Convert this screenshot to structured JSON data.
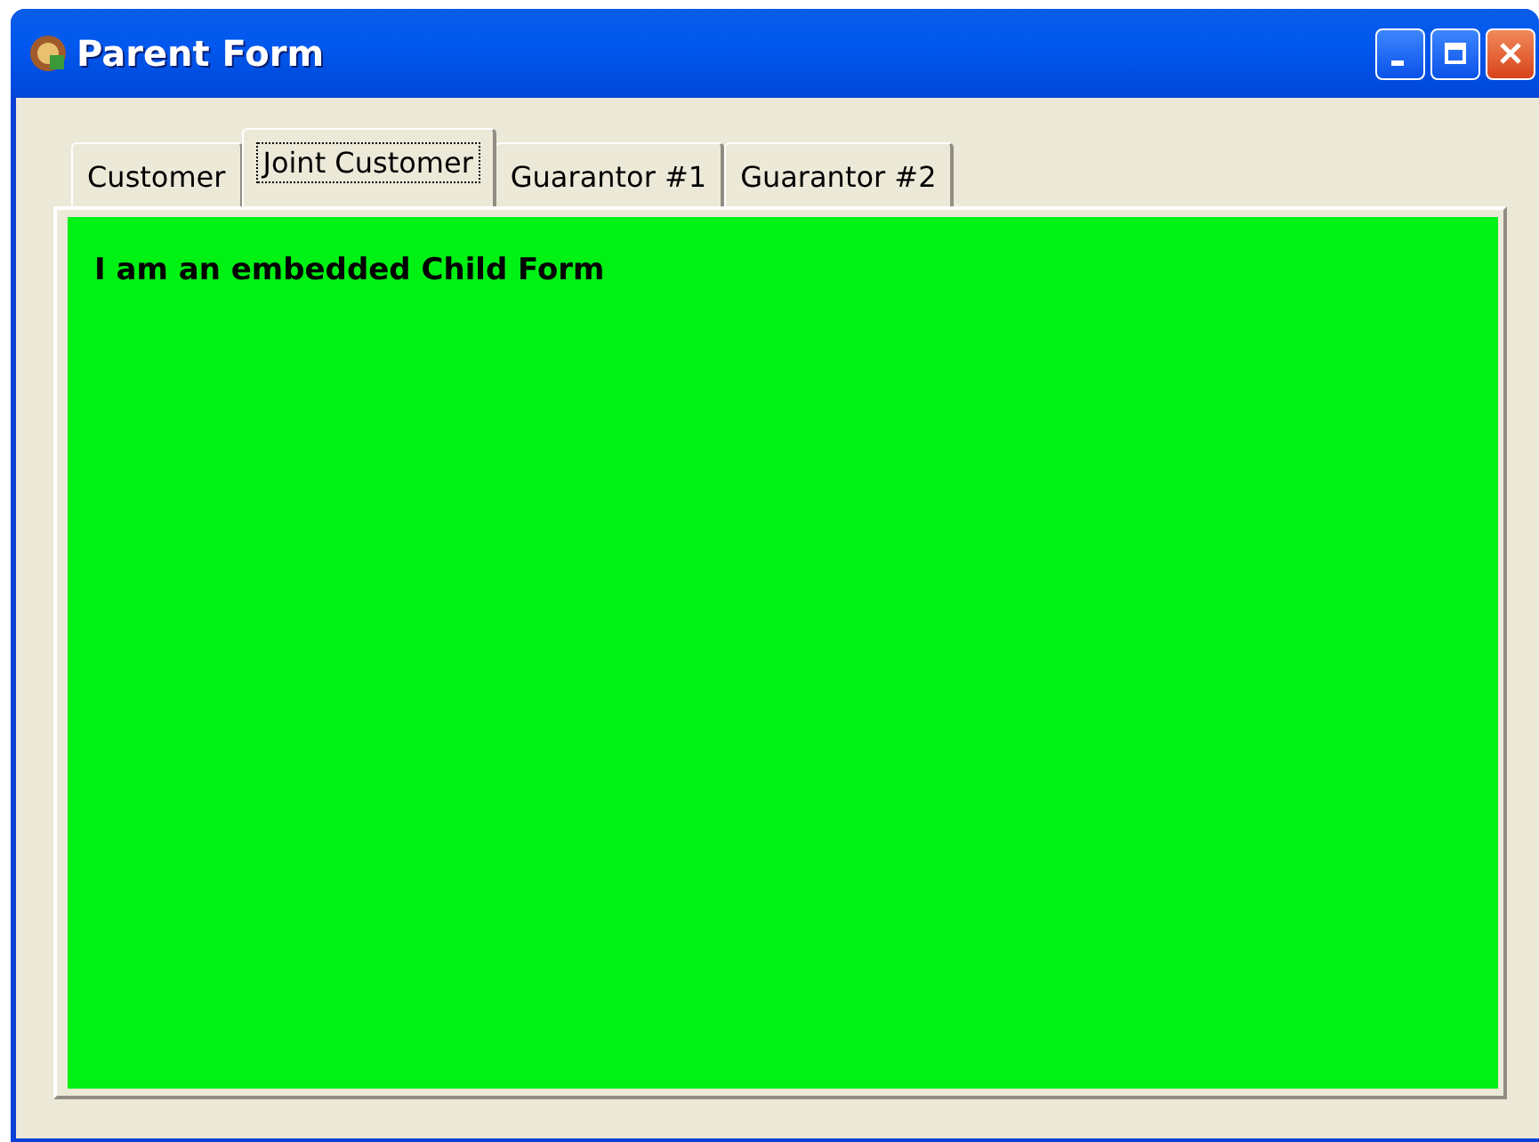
{
  "window": {
    "title": "Parent Form"
  },
  "tabs": [
    {
      "label": "Customer",
      "selected": false
    },
    {
      "label": "Joint Customer",
      "selected": true
    },
    {
      "label": "Guarantor #1",
      "selected": false
    },
    {
      "label": "Guarantor #2",
      "selected": false
    }
  ],
  "child_form": {
    "text": "I am an embedded Child Form"
  }
}
